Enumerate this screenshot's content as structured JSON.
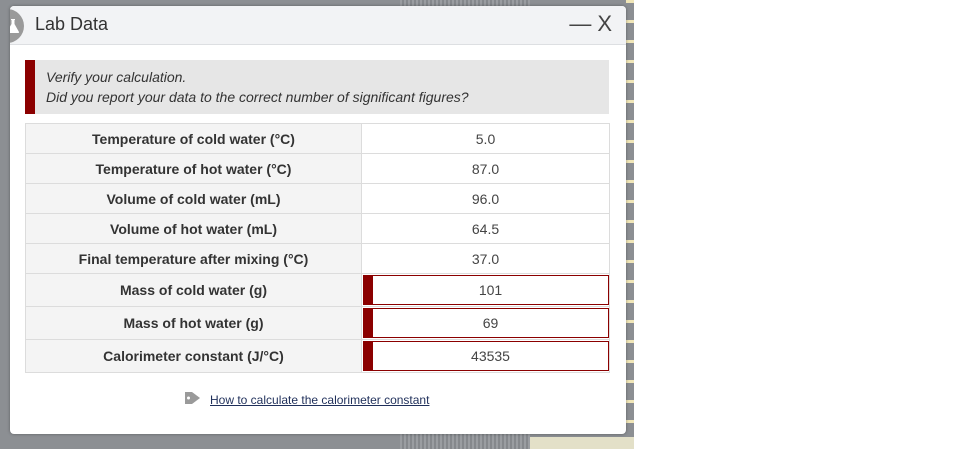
{
  "dialog": {
    "title": "Lab Data",
    "minimize_label": "—",
    "close_label": "X"
  },
  "alert": {
    "line1": "Verify your calculation.",
    "line2": "Did you report your data to the correct number of significant figures?"
  },
  "rows": [
    {
      "label": "Temperature of cold water (°C)",
      "value": "5.0"
    },
    {
      "label": "Temperature of hot water (°C)",
      "value": "87.0"
    },
    {
      "label": "Volume of cold water (mL)",
      "value": "96.0"
    },
    {
      "label": "Volume of hot water (mL)",
      "value": "64.5"
    },
    {
      "label": "Final temperature after mixing (°C)",
      "value": "37.0"
    }
  ],
  "inputs": [
    {
      "label": "Mass of cold water (g)",
      "value": "101"
    },
    {
      "label": "Mass of hot water (g)",
      "value": "69"
    },
    {
      "label": "Calorimeter constant (J/°C)",
      "value": "43535"
    }
  ],
  "help_link": "How to calculate the calorimeter constant",
  "colors": {
    "error": "#8b0000",
    "alert_bg": "#e6e6e6"
  }
}
